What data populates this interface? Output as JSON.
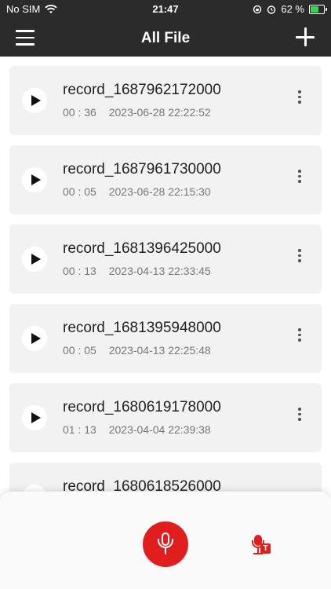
{
  "status": {
    "carrier": "No SIM",
    "time": "21:47",
    "battery_text": "62 %",
    "battery_level": 0.62
  },
  "header": {
    "title": "All File"
  },
  "records": [
    {
      "name": "record_1687962172000",
      "duration": "00 : 36",
      "datetime": "2023-06-28 22:22:52"
    },
    {
      "name": "record_1687961730000",
      "duration": "00 : 05",
      "datetime": "2023-06-28 22:15:30"
    },
    {
      "name": "record_1681396425000",
      "duration": "00 : 13",
      "datetime": "2023-04-13 22:33:45"
    },
    {
      "name": "record_1681395948000",
      "duration": "00 : 05",
      "datetime": "2023-04-13 22:25:48"
    },
    {
      "name": "record_1680619178000",
      "duration": "01 : 13",
      "datetime": "2023-04-04 22:39:38"
    },
    {
      "name": "record_1680618526000"
    }
  ],
  "bottom": {
    "transcribe_badge": "T"
  },
  "colors": {
    "header_bg": "#2b2b2b",
    "accent_red": "#e01e1e",
    "card_bg": "#f2f2f2",
    "battery_green": "#39d353"
  },
  "icons": {
    "menu": "hamburger-menu-icon",
    "add": "plus-icon",
    "play": "play-icon",
    "more": "vertical-ellipsis-icon",
    "record": "microphone-icon",
    "transcribe": "microphone-text-icon",
    "wifi": "wifi-icon",
    "orientation_lock": "orientation-lock-icon",
    "alarm": "alarm-icon",
    "battery": "battery-charging-icon"
  }
}
